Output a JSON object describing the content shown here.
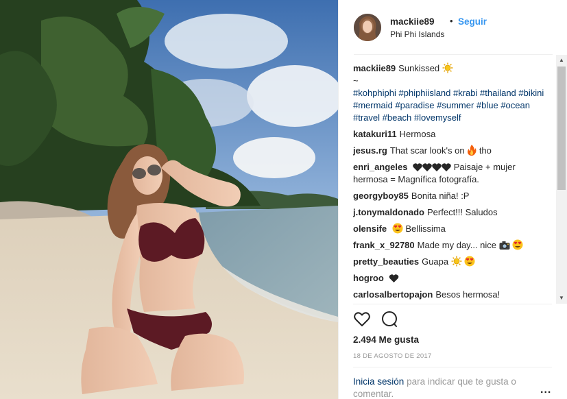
{
  "post": {
    "username": "mackiie89",
    "separator": "•",
    "follow_label": "Seguir",
    "location": "Phi Phi Islands"
  },
  "caption": {
    "username": "mackiie89",
    "text": "Sunkissed",
    "tilde": "~",
    "hashtags": "#kohphiphi #phiphiisland #krabi #thailand #bikini #mermaid #paradise #summer #blue #ocean #travel #beach #lovemyself"
  },
  "comments": [
    {
      "user": "katakuri11",
      "text": "Hermosa"
    },
    {
      "user": "jesus.rg",
      "text": "That scar look's on",
      "text_after": "tho"
    },
    {
      "user": "enri_angeles",
      "text": "Paisaje + mujer hermosa = Magnífica fotografía."
    },
    {
      "user": "georgyboy85",
      "text": "Bonita niña! :P"
    },
    {
      "user": "j.tonymaldonado",
      "text": "Perfect!!! Saludos"
    },
    {
      "user": "olensife",
      "text": "Bellissima"
    },
    {
      "user": "frank_x_92780",
      "text": "Made my day... nice"
    },
    {
      "user": "pretty_beauties",
      "text": "Guapa"
    },
    {
      "user": "hogroo",
      "text": ""
    },
    {
      "user": "carlosalbertopajon",
      "text": "Besos hermosa!"
    }
  ],
  "icons": {
    "caption_emoji": "sun-emoji-icon",
    "fire": "fire-emoji-icon",
    "hearts": "black-hearts-emoji-icon",
    "heart_eyes": "heart-eyes-emoji-icon",
    "camera": "camera-emoji-icon",
    "sun": "sun-emoji-icon",
    "black_heart": "black-heart-emoji-icon",
    "like": "heart-outline-icon",
    "comment": "speech-bubble-icon",
    "more": "more-options-icon"
  },
  "stats": {
    "likes": "2.494 Me gusta",
    "date": "18 DE AGOSTO DE 2017"
  },
  "footer": {
    "login_link": "Inicia sesión",
    "login_text": "para indicar que te gusta o comentar.",
    "more": "..."
  },
  "colors": {
    "link": "#3897f0",
    "hashtag": "#003569",
    "muted": "#999999",
    "text": "#262626"
  }
}
